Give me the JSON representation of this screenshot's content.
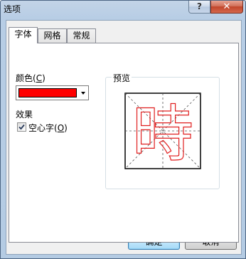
{
  "window": {
    "title": "选项",
    "help_label": "?",
    "close_label": "✕"
  },
  "tabs": [
    {
      "label": "字体",
      "active": true
    },
    {
      "label": "网格",
      "active": false
    },
    {
      "label": "常规",
      "active": false
    }
  ],
  "font_tab": {
    "color_label": "颜色",
    "color_mnemonic": "C",
    "color_value": "#ff0000",
    "effects_label": "效果",
    "hollow_label": "空心字",
    "hollow_mnemonic": "O",
    "hollow_checked": true,
    "preview_label": "预览",
    "preview_char": "時"
  },
  "buttons": {
    "ok": "确定",
    "cancel": "取消"
  }
}
